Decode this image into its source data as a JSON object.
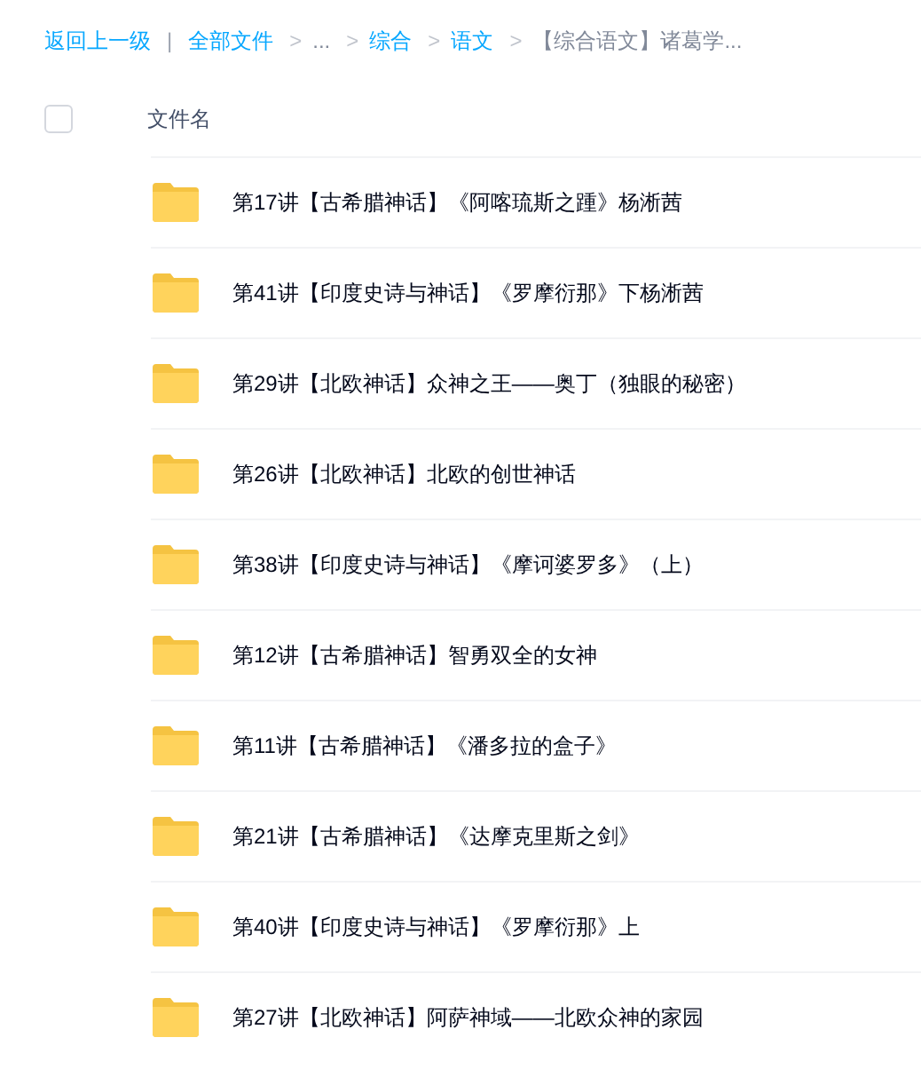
{
  "breadcrumb": [
    {
      "kind": "link",
      "label": "返回上一级"
    },
    {
      "kind": "divider",
      "label": "|"
    },
    {
      "kind": "link",
      "label": "全部文件"
    },
    {
      "kind": "arrow",
      "label": ">"
    },
    {
      "kind": "text",
      "label": "..."
    },
    {
      "kind": "arrow",
      "label": ">"
    },
    {
      "kind": "link",
      "label": "综合"
    },
    {
      "kind": "arrow",
      "label": ">"
    },
    {
      "kind": "link",
      "label": "语文"
    },
    {
      "kind": "arrow",
      "label": ">"
    },
    {
      "kind": "text",
      "label": "【综合语文】诸葛学..."
    }
  ],
  "header": {
    "checked": false,
    "column_label": "文件名"
  },
  "files": [
    {
      "name": "第17讲【古希腊神话】《阿喀琉斯之踵》杨淅茜"
    },
    {
      "name": "第41讲【印度史诗与神话】《罗摩衍那》下杨淅茜"
    },
    {
      "name": "第29讲【北欧神话】众神之王——奥丁（独眼的秘密）"
    },
    {
      "name": "第26讲【北欧神话】北欧的创世神话"
    },
    {
      "name": "第38讲【印度史诗与神话】《摩诃婆罗多》（上）"
    },
    {
      "name": "第12讲【古希腊神话】智勇双全的女神"
    },
    {
      "name": "第11讲【古希腊神话】《潘多拉的盒子》"
    },
    {
      "name": "第21讲【古希腊神话】《达摩克里斯之剑》"
    },
    {
      "name": "第40讲【印度史诗与神话】《罗摩衍那》上"
    },
    {
      "name": "第27讲【北欧神话】阿萨神域——北欧众神的家园"
    }
  ]
}
